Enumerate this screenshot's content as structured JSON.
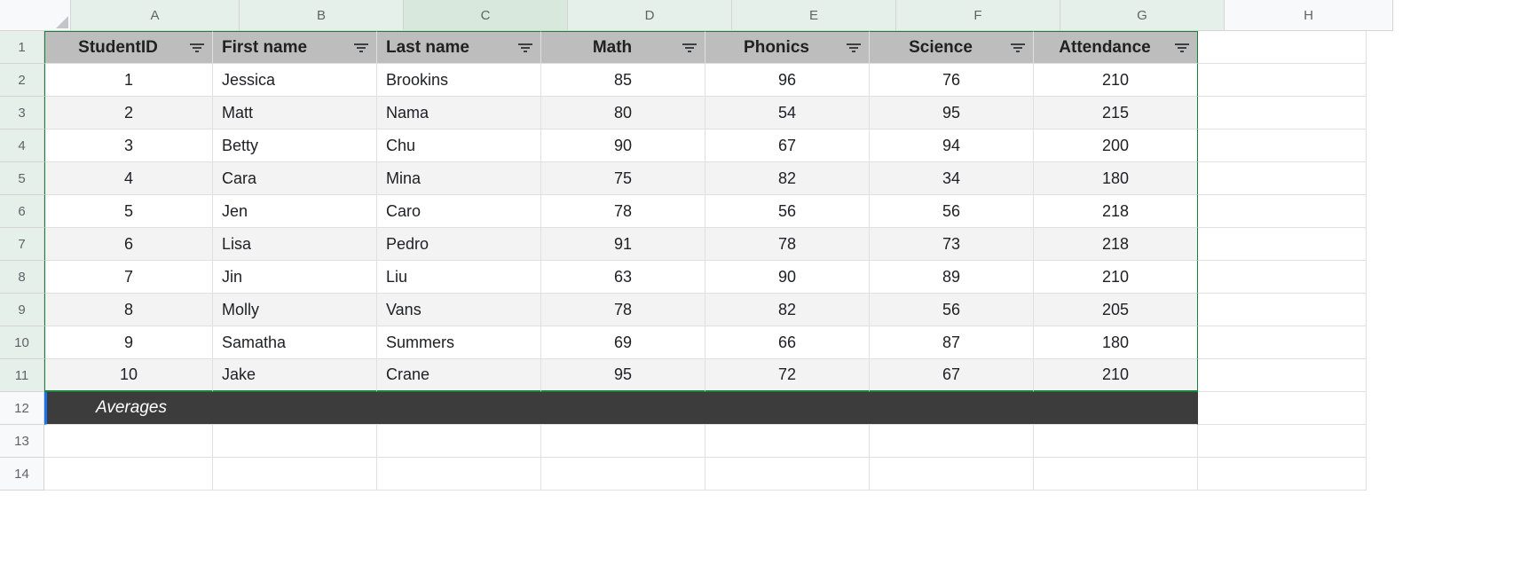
{
  "columns": [
    "A",
    "B",
    "C",
    "D",
    "E",
    "F",
    "G",
    "H"
  ],
  "row_numbers": [
    1,
    2,
    3,
    4,
    5,
    6,
    7,
    8,
    9,
    10,
    11,
    12,
    13,
    14
  ],
  "headers": {
    "studentid": "StudentID",
    "firstname": "First name",
    "lastname": "Last name",
    "math": "Math",
    "phonics": "Phonics",
    "science": "Science",
    "attendance": "Attendance"
  },
  "rows": [
    {
      "id": 1,
      "first": "Jessica",
      "last": "Brookins",
      "math": 85,
      "phonics": 96,
      "science": 76,
      "attendance": 210
    },
    {
      "id": 2,
      "first": "Matt",
      "last": "Nama",
      "math": 80,
      "phonics": 54,
      "science": 95,
      "attendance": 215
    },
    {
      "id": 3,
      "first": "Betty",
      "last": "Chu",
      "math": 90,
      "phonics": 67,
      "science": 94,
      "attendance": 200
    },
    {
      "id": 4,
      "first": "Cara",
      "last": "Mina",
      "math": 75,
      "phonics": 82,
      "science": 34,
      "attendance": 180
    },
    {
      "id": 5,
      "first": "Jen",
      "last": "Caro",
      "math": 78,
      "phonics": 56,
      "science": 56,
      "attendance": 218
    },
    {
      "id": 6,
      "first": "Lisa",
      "last": "Pedro",
      "math": 91,
      "phonics": 78,
      "science": 73,
      "attendance": 218
    },
    {
      "id": 7,
      "first": "Jin",
      "last": "Liu",
      "math": 63,
      "phonics": 90,
      "science": 89,
      "attendance": 210
    },
    {
      "id": 8,
      "first": "Molly",
      "last": "Vans",
      "math": 78,
      "phonics": 82,
      "science": 56,
      "attendance": 205
    },
    {
      "id": 9,
      "first": "Samatha",
      "last": "Summers",
      "math": 69,
      "phonics": 66,
      "science": 87,
      "attendance": 180
    },
    {
      "id": 10,
      "first": "Jake",
      "last": "Crane",
      "math": 95,
      "phonics": 72,
      "science": 67,
      "attendance": 210
    }
  ],
  "averages_label": "Averages"
}
